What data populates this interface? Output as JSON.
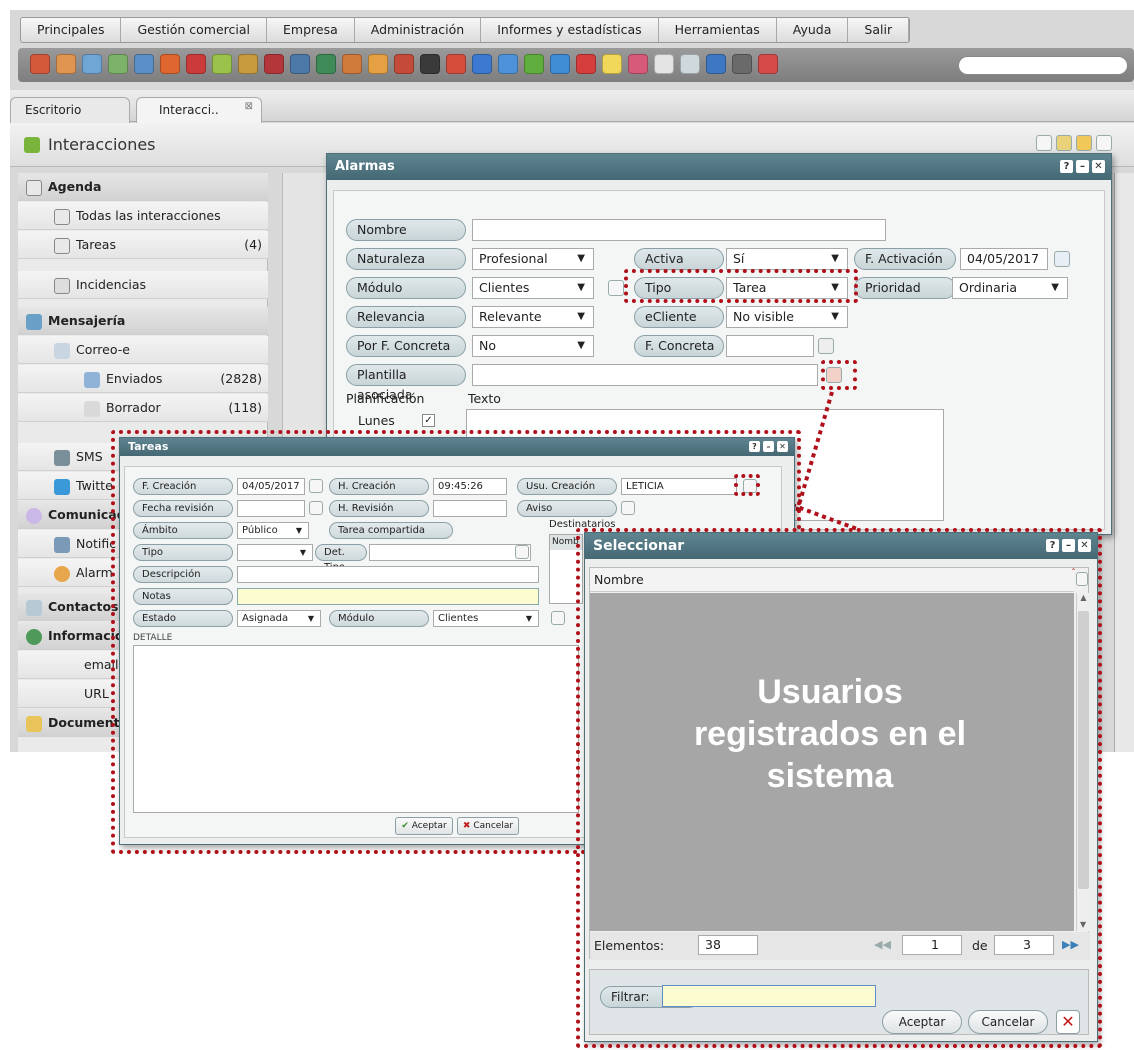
{
  "menu": [
    "Principales",
    "Gestión comercial",
    "Empresa",
    "Administración",
    "Informes y estadísticas",
    "Herramientas",
    "Ayuda",
    "Salir"
  ],
  "tabs": {
    "escritorio": "Escritorio",
    "interacciones": "Interacci.."
  },
  "page": {
    "title": "Interacciones"
  },
  "sidebar": {
    "agenda": "Agenda",
    "todas": "Todas las interacciones",
    "tareas": "Tareas",
    "tareas_count": "(4)",
    "incidencias": "Incidencias",
    "mensajeria": "Mensajería",
    "correo": "Correo-e",
    "enviados": "Enviados",
    "enviados_count": "(2828)",
    "borrador": "Borrador",
    "borrador_count": "(118)",
    "sms": "SMS",
    "twitter": "Twitte",
    "comunicaciones": "Comunicac",
    "notif": "Notific",
    "alarmas": "Alarm",
    "contactos": "Contactos",
    "informacion": "Informació",
    "email": "email",
    "url": "URL",
    "documentos": "Documenta"
  },
  "alarmas": {
    "title": "Alarmas",
    "nombre": "Nombre",
    "naturaleza": "Naturaleza",
    "naturaleza_val": "Profesional",
    "activa": "Activa",
    "activa_val": "Sí",
    "f_activacion": "F. Activación",
    "f_activacion_val": "04/05/2017",
    "modulo": "Módulo",
    "modulo_val": "Clientes",
    "tipo": "Tipo",
    "tipo_val": "Tarea",
    "prioridad": "Prioridad",
    "prioridad_val": "Ordinaria",
    "relevancia": "Relevancia",
    "relevancia_val": "Relevante",
    "ecliente": "eCliente",
    "ecliente_val": "No visible",
    "por_fecha": "Por F. Concreta",
    "por_fecha_val": "No",
    "f_concreta": "F. Concreta",
    "plantilla": "Plantilla asociada",
    "planificacion": "Planificación",
    "texto": "Texto",
    "lunes": "Lunes"
  },
  "tareas": {
    "title": "Tareas",
    "f_creacion": "F. Creación",
    "f_creacion_val": "04/05/2017",
    "h_creacion": "H. Creación",
    "h_creacion_val": "09:45:26",
    "usu_creacion": "Usu. Creación",
    "usu_creacion_val": "LETICIA",
    "fecha_revision": "Fecha revisión",
    "h_revision": "H. Revisión",
    "aviso": "Aviso",
    "ambito": "Ámbito",
    "ambito_val": "Público",
    "tarea_compartida": "Tarea compartida",
    "destinatarios": "Destinatarios",
    "nombre_col": "Nomb",
    "tipo": "Tipo",
    "det_tipo": "Det. Tipo",
    "descripcion": "Descripción",
    "notas": "Notas",
    "estado": "Estado",
    "estado_val": "Asignada",
    "modulo": "Módulo",
    "modulo_val": "Clientes",
    "detalle": "DETALLE",
    "aceptar": "Aceptar",
    "cancelar": "Cancelar"
  },
  "seleccionar": {
    "title": "Seleccionar",
    "col_nombre": "Nombre",
    "overlay": "Usuarios registrados en el sistema",
    "elementos_label": "Elementos:",
    "elementos_val": "38",
    "page_val": "1",
    "de": "de",
    "page_total": "3",
    "filtrar": "Filtrar:",
    "aceptar": "Aceptar",
    "cancelar": "Cancelar"
  },
  "colors": {
    "title_bar": "#4f7480",
    "highlight": "#b0101a",
    "input_yellow": "#fdfbd0"
  }
}
